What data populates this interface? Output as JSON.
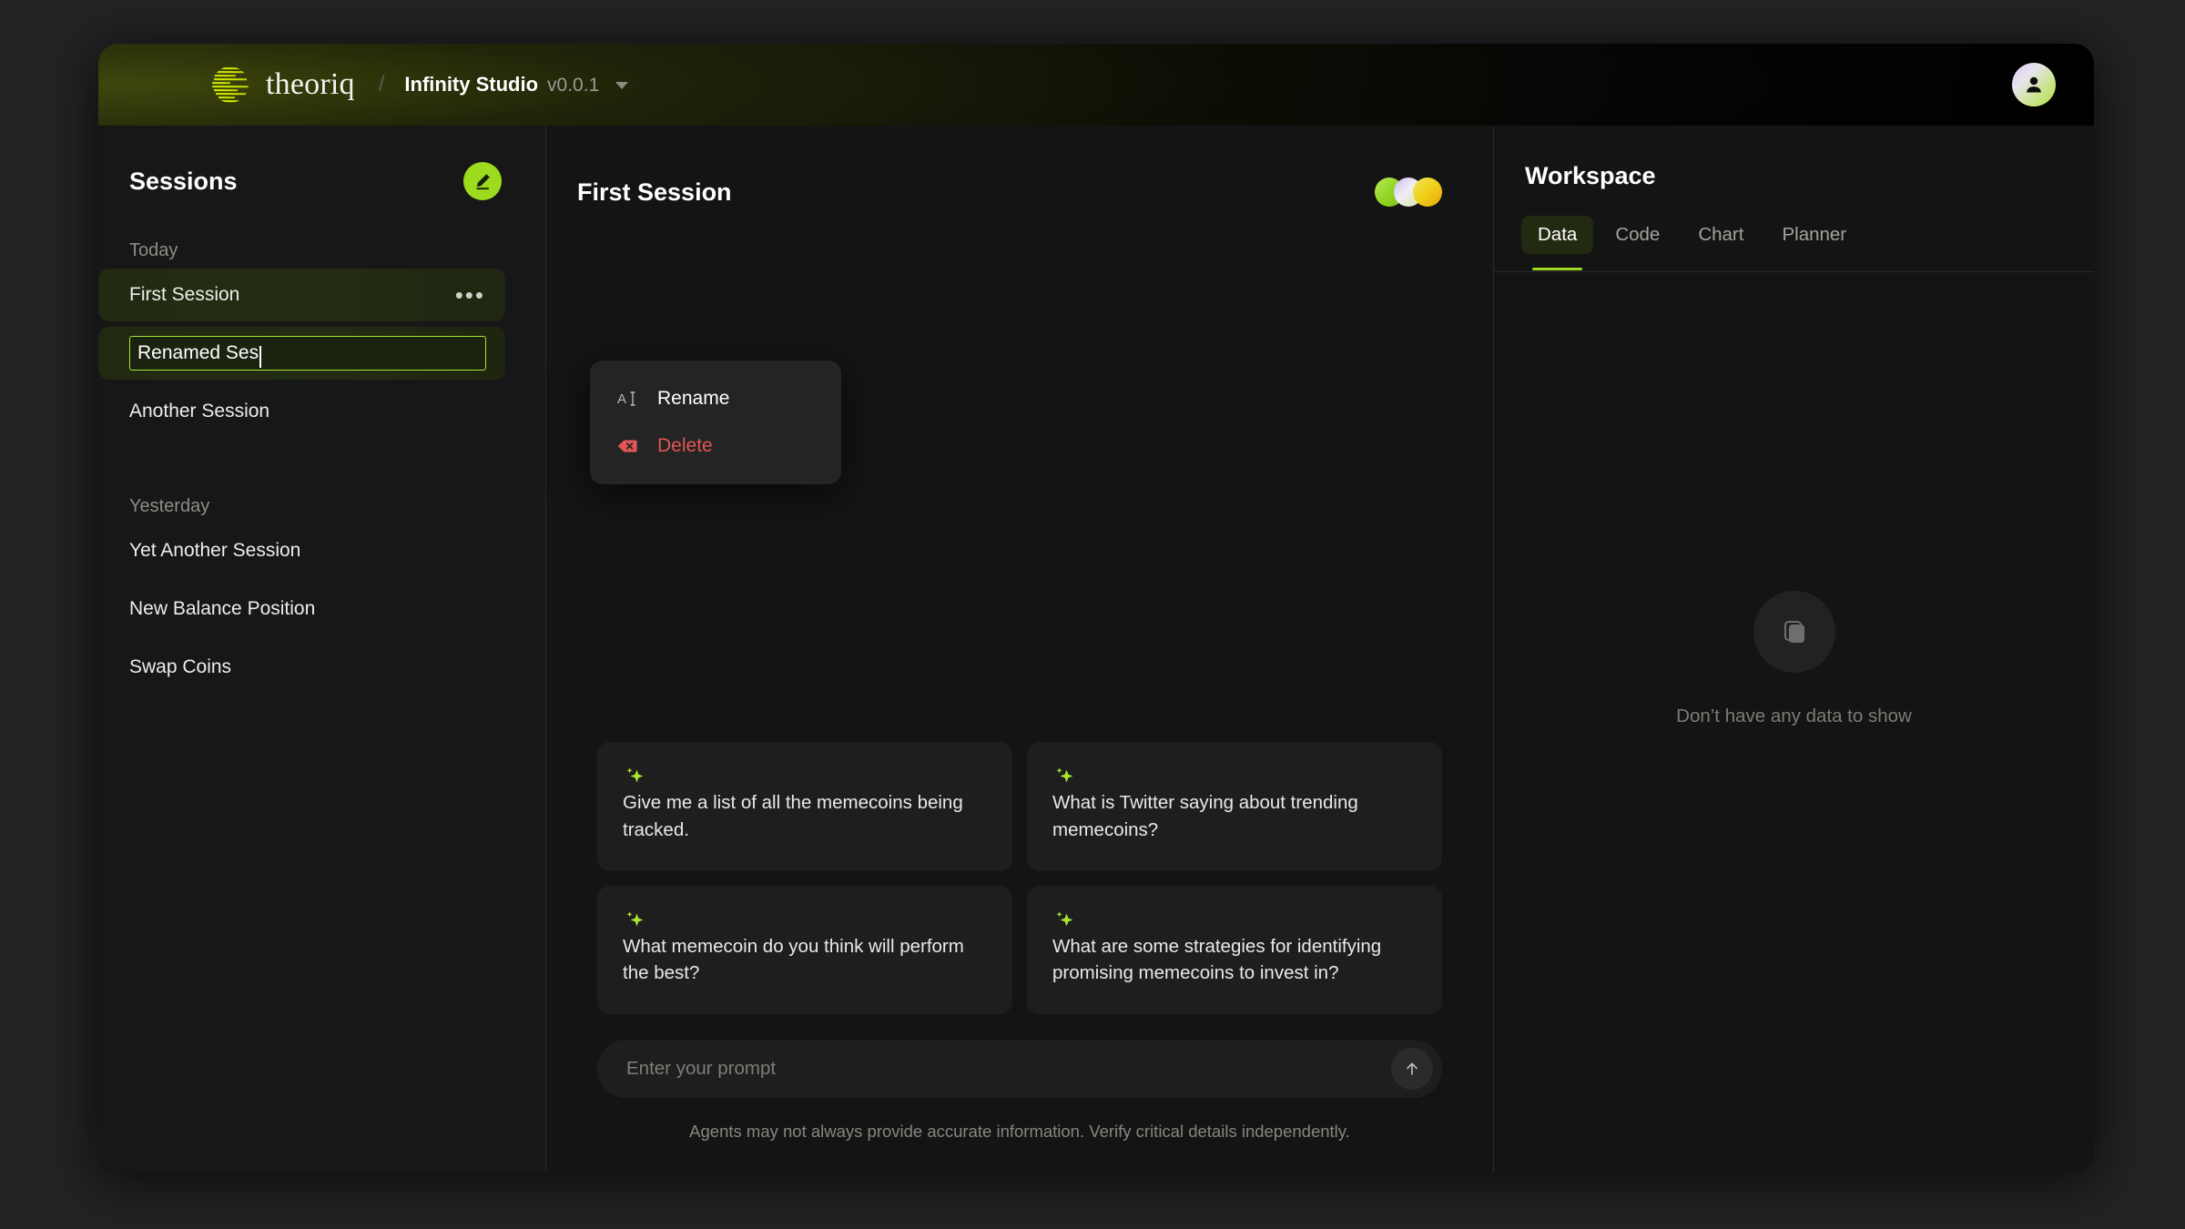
{
  "topbar": {
    "brand_name": "theoriq",
    "separator": "/",
    "app_title": "Infinity Studio",
    "app_version": "v0.0.1",
    "logo_icon": "theoriq-striped-circle-logo",
    "caret_icon": "chevron-down-icon",
    "avatar_icon": "user-avatar-icon"
  },
  "sessions": {
    "title": "Sessions",
    "new_session_icon": "pencil-edit-icon",
    "groups": [
      {
        "label": "Today",
        "items": [
          {
            "label": "First Session",
            "state": "active",
            "dots": "•••"
          },
          {
            "label": "Renamed Ses",
            "state": "editing"
          },
          {
            "label": "Another Session",
            "state": "normal"
          }
        ]
      },
      {
        "label": "Yesterday",
        "items": [
          {
            "label": "Yet Another Session",
            "state": "normal"
          },
          {
            "label": "New Balance Position",
            "state": "normal"
          },
          {
            "label": "Swap Coins",
            "state": "normal"
          }
        ]
      }
    ]
  },
  "context_menu": {
    "items": [
      {
        "label": "Rename",
        "icon": "text-cursor-icon",
        "color": "#ffffff"
      },
      {
        "label": "Delete",
        "icon": "delete-backspace-icon",
        "color": "#e05555"
      }
    ]
  },
  "chat": {
    "title": "First Session",
    "agent_dots": [
      "green",
      "violet",
      "yellow"
    ],
    "suggestions": [
      {
        "icon": "sparkle-icon",
        "text": "Give me a list of all the memecoins being tracked."
      },
      {
        "icon": "sparkle-icon",
        "text": "What is Twitter saying about trending memecoins?"
      },
      {
        "icon": "sparkle-icon",
        "text": "What memecoin do you think will perform the best?"
      },
      {
        "icon": "sparkle-icon",
        "text": "What are some strategies for identifying promising memecoins to invest in?"
      }
    ],
    "prompt_placeholder": "Enter your prompt",
    "prompt_value": "",
    "send_icon": "arrow-up-icon",
    "disclaimer": "Agents may not always provide accurate information. Verify critical details independently."
  },
  "workspace": {
    "title": "Workspace",
    "tabs": [
      {
        "label": "Data",
        "active": true
      },
      {
        "label": "Code",
        "active": false
      },
      {
        "label": "Chart",
        "active": false
      },
      {
        "label": "Planner",
        "active": false
      }
    ],
    "empty_icon": "stacked-layers-icon",
    "empty_text": "Don’t have any data to show"
  },
  "colors": {
    "accent_green": "#9ddb1f",
    "danger_red": "#e05555",
    "window_bg": "#141414",
    "panel_bg": "#171717",
    "card_bg": "#1e1e1e"
  }
}
